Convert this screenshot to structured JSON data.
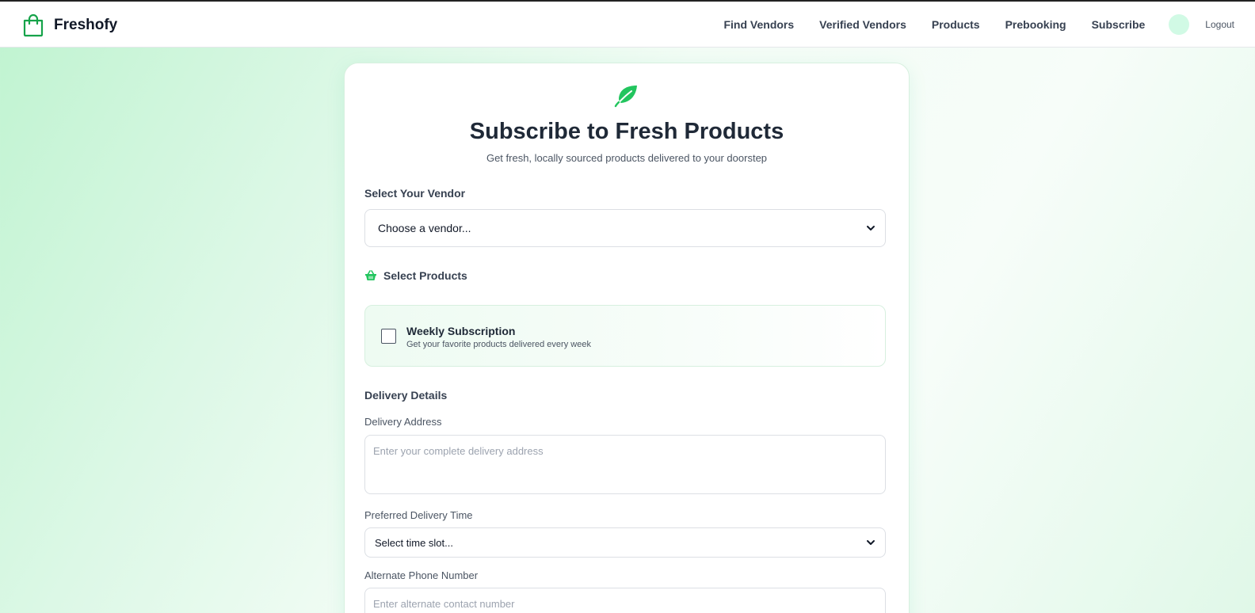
{
  "header": {
    "brand": "Freshofy",
    "nav": [
      "Find Vendors",
      "Verified Vendors",
      "Products",
      "Prebooking",
      "Subscribe"
    ],
    "logout": "Logout"
  },
  "form": {
    "title": "Subscribe to Fresh Products",
    "subtitle": "Get fresh, locally sourced products delivered to your doorstep",
    "vendor_label": "Select Your Vendor",
    "vendor_selected": "Choose a vendor...",
    "products_label": "Select Products",
    "subscription": {
      "title": "Weekly Subscription",
      "description": "Get your favorite products delivered every week",
      "checked": false
    },
    "delivery_heading": "Delivery Details",
    "address_label": "Delivery Address",
    "address_placeholder": "Enter your complete delivery address",
    "time_label": "Preferred Delivery Time",
    "time_selected": "Select time slot...",
    "phone_label": "Alternate Phone Number",
    "phone_placeholder": "Enter alternate contact number"
  },
  "colors": {
    "accent": "#22c55e",
    "brand_icon": "#16a34a",
    "avatar": "#d1fae5"
  },
  "icons": {
    "brand": "shopping-bag-icon",
    "hero": "leaf-icon",
    "products": "basket-icon",
    "select": "chevron-down-icon"
  }
}
